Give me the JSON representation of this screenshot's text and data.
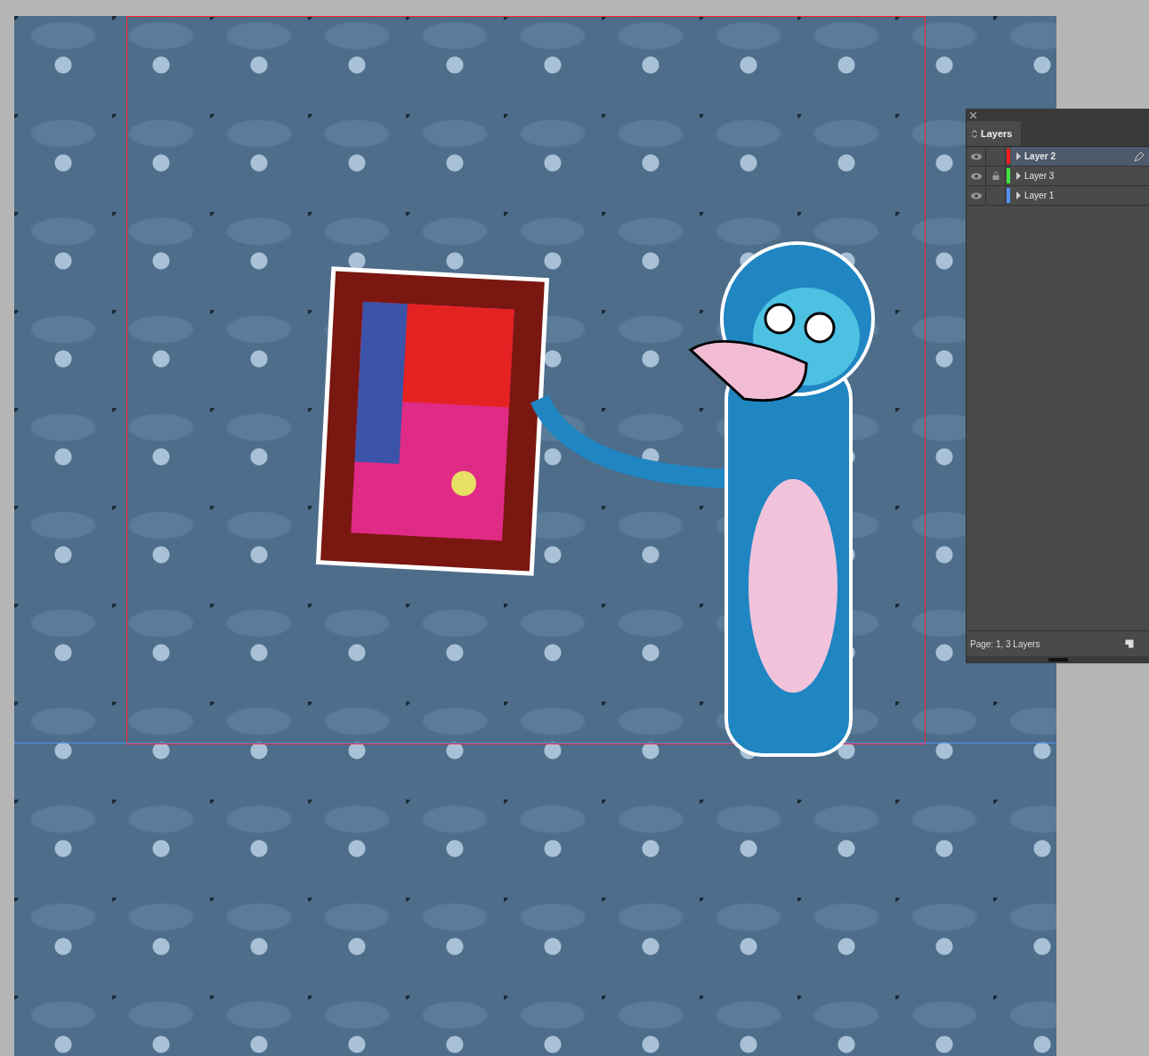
{
  "panel": {
    "title": "Layers",
    "layers": [
      {
        "name": "Layer 2",
        "color": "#ff1a1a",
        "visible": true,
        "locked": false,
        "selected": true
      },
      {
        "name": "Layer 3",
        "color": "#3ee83e",
        "visible": true,
        "locked": true,
        "selected": false
      },
      {
        "name": "Layer 1",
        "color": "#4f8ff7",
        "visible": true,
        "locked": false,
        "selected": false
      }
    ],
    "status": "Page: 1, 3 Layers"
  }
}
